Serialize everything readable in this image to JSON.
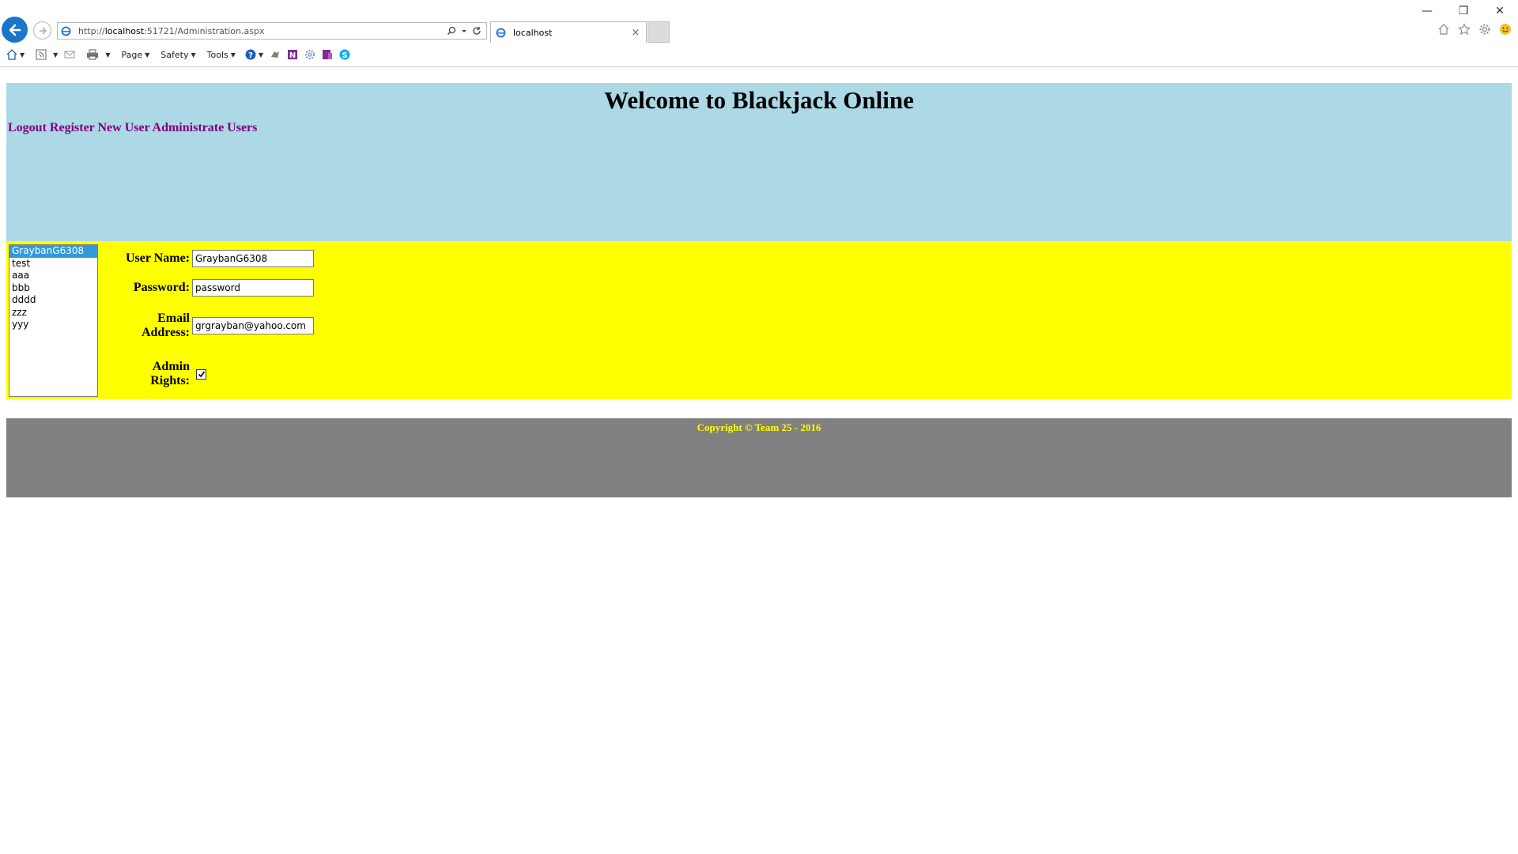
{
  "browser": {
    "url_prefix": "http://",
    "url_host": "localhost",
    "url_rest": ":51721/Administration.aspx",
    "tab_title": "localhost",
    "tab_close": "×",
    "window_buttons": {
      "minimize": "—",
      "restore": "❐",
      "close": "✕"
    },
    "command_menus": [
      "Page",
      "Safety",
      "Tools"
    ]
  },
  "site": {
    "title": "Welcome to Blackjack Online",
    "nav": [
      "Logout",
      "Register New User",
      "Administrate Users"
    ]
  },
  "users": {
    "selected_index": 0,
    "items": [
      "GraybanG6308",
      "test",
      "aaa",
      "bbb",
      "dddd",
      "zzz",
      "yyy"
    ]
  },
  "form": {
    "username_label": "User Name:",
    "username_value": "GraybanG6308",
    "password_label": "Password:",
    "password_value": "password",
    "email_label_1": "Email",
    "email_label_2": "Address:",
    "email_value": "grgrayban@yahoo.com",
    "admin_label_1": "Admin",
    "admin_label_2": "Rights:",
    "admin_checked": true
  },
  "footer": {
    "copyright": "Copyright © Team 25 - 2016"
  },
  "colors": {
    "header_bg": "#add8e6",
    "content_bg": "#ffff00",
    "footer_bg": "#808080",
    "footer_text": "#ffff00",
    "nav_link": "#800080",
    "selection": "#3399dd"
  }
}
